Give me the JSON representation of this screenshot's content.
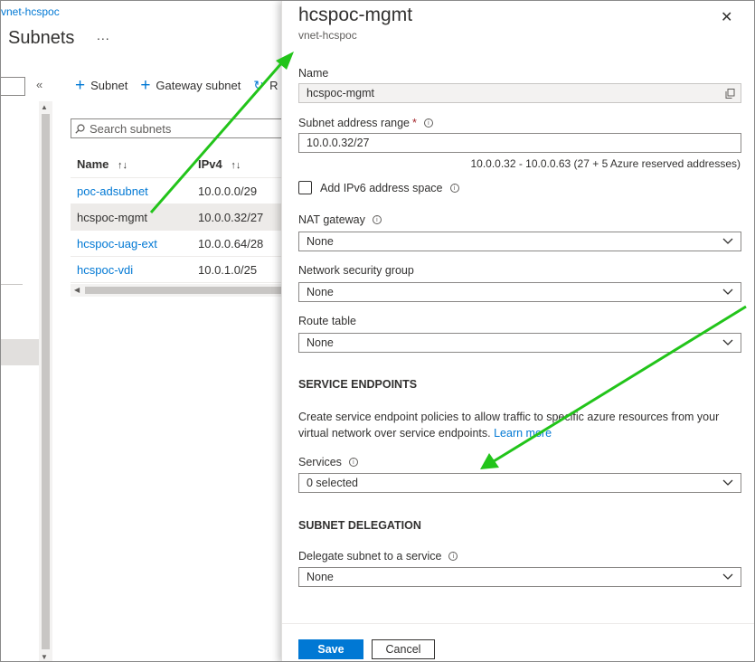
{
  "background": {
    "breadcrumb": "vnet-hcspoc",
    "title": "Subnets",
    "more": "...",
    "collapse": "«",
    "toolbar": {
      "subnet": "Subnet",
      "gateway_subnet": "Gateway subnet",
      "refresh_partial": "R"
    },
    "search_placeholder": "Search subnets",
    "table": {
      "headers": [
        "Name",
        "IPv4"
      ],
      "sort_glyph": "↑↓",
      "rows": [
        {
          "name": "poc-adsubnet",
          "ipv4": "10.0.0.0/29"
        },
        {
          "name": "hcspoc-mgmt",
          "ipv4": "10.0.0.32/27"
        },
        {
          "name": "hcspoc-uag-ext",
          "ipv4": "10.0.0.64/28"
        },
        {
          "name": "hcspoc-vdi",
          "ipv4": "10.0.1.0/25"
        }
      ]
    }
  },
  "panel": {
    "title": "hcspoc-mgmt",
    "subtitle": "vnet-hcspoc",
    "close": "✕",
    "name_label": "Name",
    "name_value": "hcspoc-mgmt",
    "address_label": "Subnet address range",
    "required_mark": "*",
    "address_value": "10.0.0.32/27",
    "address_hint": "10.0.0.32 - 10.0.0.63 (27 + 5 Azure reserved addresses)",
    "ipv6_label": "Add IPv6 address space",
    "nat_label": "NAT gateway",
    "nat_value": "None",
    "nsg_label": "Network security group",
    "nsg_value": "None",
    "route_label": "Route table",
    "route_value": "None",
    "service_endpoints_heading": "SERVICE ENDPOINTS",
    "service_endpoints_text": "Create service endpoint policies to allow traffic to specific azure resources from your virtual network over service endpoints.",
    "learn_more": "Learn more",
    "services_label": "Services",
    "services_value": "0 selected",
    "delegation_heading": "SUBNET DELEGATION",
    "delegate_label": "Delegate subnet to a service",
    "delegate_value": "None",
    "save": "Save",
    "cancel": "Cancel"
  },
  "colors": {
    "accent": "#0078d4",
    "annotation_arrow": "#22c41a"
  },
  "icons": [
    "plus-icon",
    "refresh-icon",
    "search-icon",
    "copy-icon",
    "info-icon",
    "chevron-down-icon",
    "close-icon"
  ]
}
